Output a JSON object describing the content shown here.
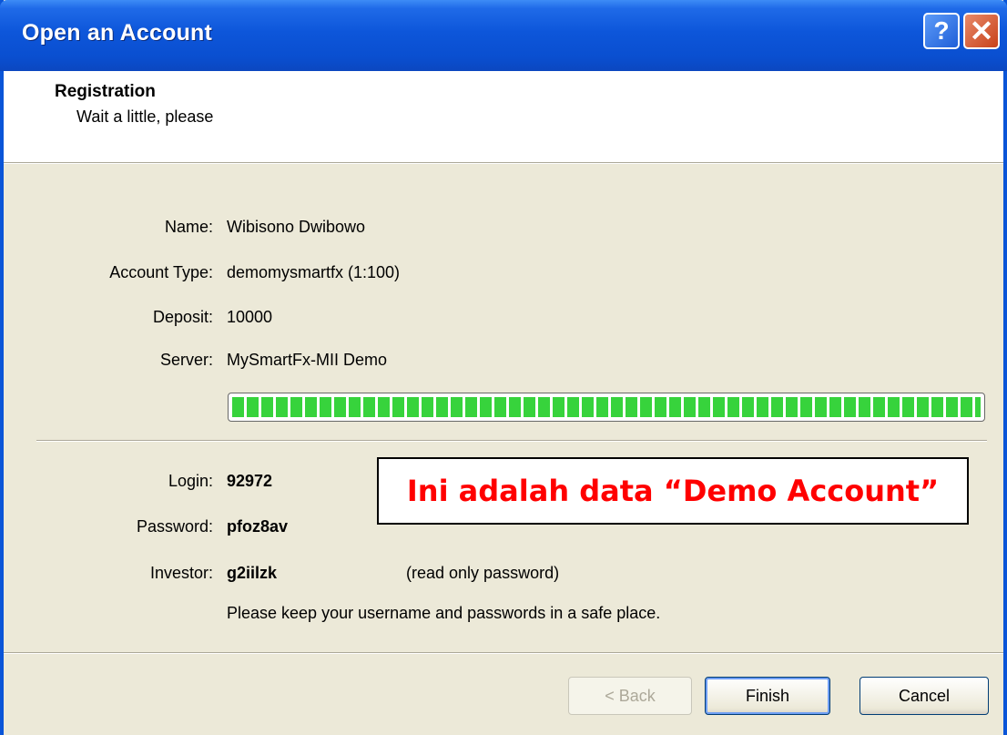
{
  "window": {
    "title": "Open an Account"
  },
  "titlebar": {
    "help_glyph": "?",
    "close_glyph": "✕"
  },
  "header": {
    "title": "Registration",
    "subtitle": "Wait a little, please"
  },
  "fields": {
    "name_label": "Name:",
    "name_value": "Wibisono Dwibowo",
    "account_type_label": "Account Type:",
    "account_type_value": "demomysmartfx (1:100)",
    "deposit_label": "Deposit:",
    "deposit_value": "10000",
    "server_label": "Server:",
    "server_value": "MySmartFx-MII Demo"
  },
  "progress": {
    "fraction": 1.0,
    "color": "#37d33c"
  },
  "credentials": {
    "login_label": "Login:",
    "login_value": "92972",
    "password_label": "Password:",
    "password_value": "pfoz8av",
    "investor_label": "Investor:",
    "investor_value": "g2iilzk",
    "investor_note": "(read only password)",
    "safety_note": "Please keep your username and passwords in a safe place."
  },
  "annotation": {
    "text": "Ini adalah data “Demo Account”",
    "color": "#ff0000"
  },
  "buttons": {
    "back": "< Back",
    "finish": "Finish",
    "cancel": "Cancel"
  },
  "icons": {
    "help": "help-icon",
    "close": "close-icon"
  }
}
